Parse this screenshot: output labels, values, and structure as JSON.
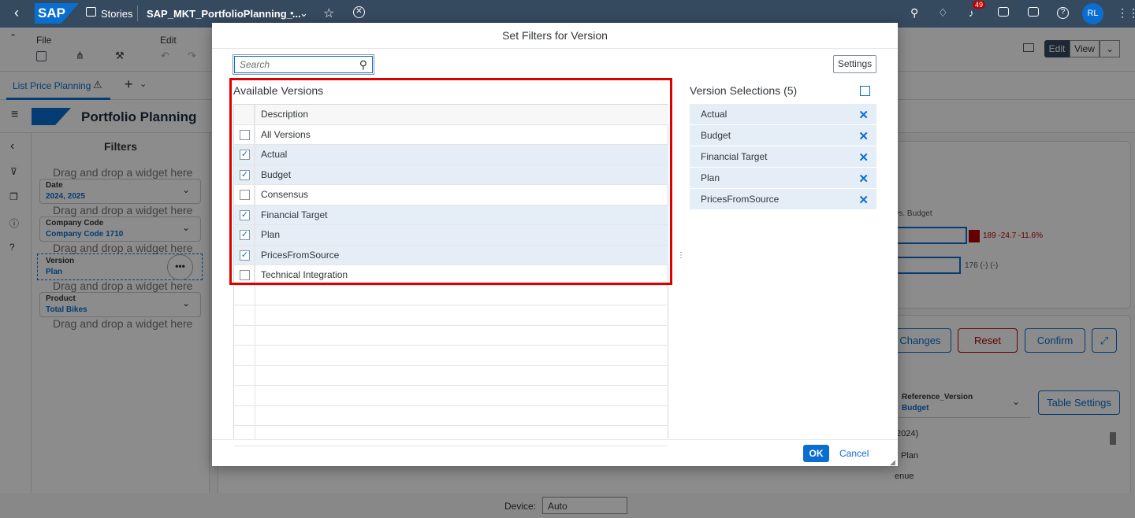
{
  "shell": {
    "logo": "SAP",
    "stories": "Stories",
    "story_name": "SAP_MKT_PortfolioPlanning_...",
    "modified_mark": "•",
    "notification_count": "49",
    "avatar": "RL"
  },
  "toolbar": {
    "file": "File",
    "edit": "Edit",
    "edit_button": "Edit",
    "view_button": "View"
  },
  "page_tab": "List Price Planning",
  "header": {
    "title": "Portfolio Planning"
  },
  "filters_panel": {
    "title": "Filters",
    "drop_hint": "Drag and drop a widget here",
    "filters": [
      {
        "label": "Date",
        "value": "2024, 2025"
      },
      {
        "label": "Company Code",
        "value": "Company Code 1710"
      },
      {
        "label": "Version",
        "value": "Plan"
      },
      {
        "label": "Product",
        "value": "Total Bikes"
      }
    ]
  },
  "background": {
    "chart_subtitle": "n vs. Budget",
    "row1_value": "189 -24.7 -11.6%",
    "row2_value": "176 (-) (-)",
    "buttons": {
      "changes": "e Changes",
      "reset": "Reset",
      "confirm": "Confirm",
      "table_settings": "Table Settings"
    },
    "reference_version_label": "Reference_Version",
    "reference_version_value": "Budget",
    "table_fragments": [
      "2024)",
      "Plan",
      "enue"
    ],
    "device_label": "Device:",
    "device_value": "Auto"
  },
  "dialog": {
    "title": "Set Filters for Version",
    "search_placeholder": "Search",
    "settings_label": "Settings",
    "available_title": "Available Versions",
    "column_header": "Description",
    "versions": [
      {
        "label": "All Versions",
        "checked": false
      },
      {
        "label": "Actual",
        "checked": true
      },
      {
        "label": "Budget",
        "checked": true
      },
      {
        "label": "Consensus",
        "checked": false
      },
      {
        "label": "Financial Target",
        "checked": true
      },
      {
        "label": "Plan",
        "checked": true
      },
      {
        "label": "PricesFromSource",
        "checked": true
      },
      {
        "label": "Technical Integration",
        "checked": false
      }
    ],
    "selections_title": "Version Selections (5)",
    "selections": [
      "Actual",
      "Budget",
      "Financial Target",
      "Plan",
      "PricesFromSource"
    ],
    "ok_label": "OK",
    "cancel_label": "Cancel"
  },
  "colors": {
    "shell": "#354a5f",
    "accent": "#0a6ed1",
    "highlight": "#dd0000",
    "selected_row": "#e5eef7"
  }
}
